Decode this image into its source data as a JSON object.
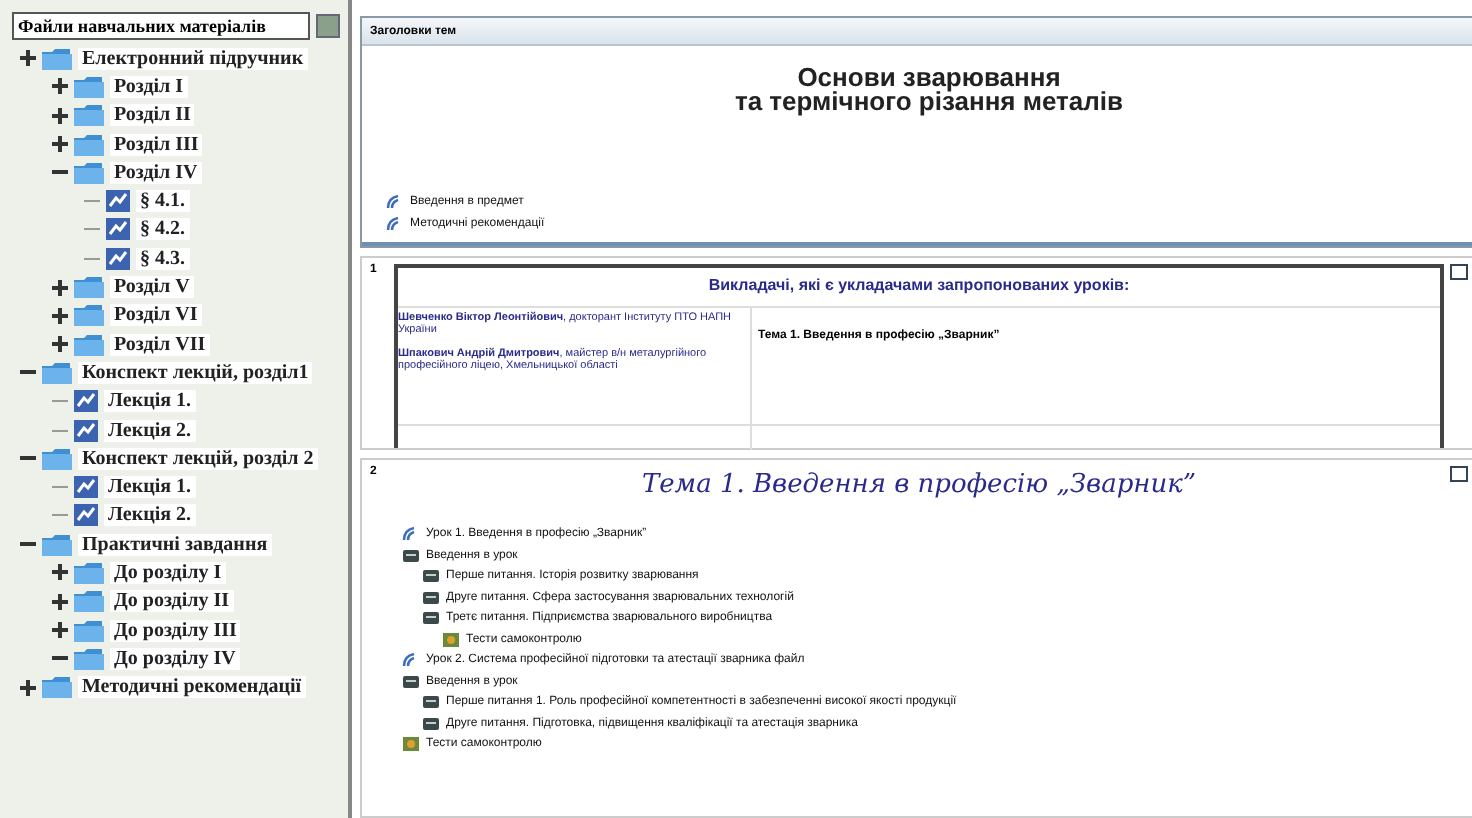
{
  "sidebar": {
    "title": "Файли навчальних матеріалів",
    "tree": [
      {
        "label": "Електронний підручник",
        "kind": "folder",
        "expanded": false,
        "children": [
          {
            "label": "Розділ I",
            "kind": "folder",
            "expanded": false
          },
          {
            "label": "Розділ II",
            "kind": "folder",
            "expanded": false
          },
          {
            "label": "Розділ III",
            "kind": "folder",
            "expanded": false
          },
          {
            "label": "Розділ IV",
            "kind": "folder",
            "expanded": true,
            "children": [
              {
                "label": "§ 4.1.",
                "kind": "page"
              },
              {
                "label": "§ 4.2.",
                "kind": "page"
              },
              {
                "label": "§ 4.3.",
                "kind": "page"
              }
            ]
          },
          {
            "label": "Розділ V",
            "kind": "folder",
            "expanded": false
          },
          {
            "label": "Розділ VI",
            "kind": "folder",
            "expanded": false
          },
          {
            "label": "Розділ VII",
            "kind": "folder",
            "expanded": false
          }
        ]
      },
      {
        "label": "Конспект лекцій, розділ1",
        "kind": "folder",
        "expanded": true,
        "children": [
          {
            "label": "Лекція 1.",
            "kind": "page"
          },
          {
            "label": "Лекція 2.",
            "kind": "page"
          }
        ]
      },
      {
        "label": "Конспект лекцій, розділ 2",
        "kind": "folder",
        "expanded": true,
        "children": [
          {
            "label": "Лекція 1.",
            "kind": "page"
          },
          {
            "label": "Лекція 2.",
            "kind": "page"
          }
        ]
      },
      {
        "label": "Практичні завдання",
        "kind": "folder",
        "expanded": true,
        "children": [
          {
            "label": "До розділу I",
            "kind": "folder",
            "expanded": false
          },
          {
            "label": "До розділу II",
            "kind": "folder",
            "expanded": false
          },
          {
            "label": "До розділу III",
            "kind": "folder",
            "expanded": false
          },
          {
            "label": "До розділу IV",
            "kind": "folder",
            "expanded": true
          }
        ]
      },
      {
        "label": "Методичні рекомендації",
        "kind": "folder",
        "expanded": false
      }
    ]
  },
  "header": {
    "label": "Заголовки тем"
  },
  "course": {
    "title_lines": [
      "Основи зварювання",
      "та термічного різання металів"
    ],
    "links": [
      "Введення в предмет",
      "Методичні рекомендації"
    ]
  },
  "sections": [
    {
      "number": "1",
      "kind": "authors",
      "title": "Викладачі, які є укладачами запропонованих уроків:",
      "authors": [
        "**Шевченко Віктор Леонтійович**, докторант Інституту ПТО НАПН України",
        "**Шпакович Андрій Дмитрович**, майстер в/н металургійного професійного ліцею, Хмельницької області"
      ],
      "topic": "Тема 1. Введення в професію „Зварник”"
    },
    {
      "number": "2",
      "kind": "lessons",
      "title": "Тема 1. Введення в професію „Зварник”",
      "items": [
        {
          "label": "Урок 1. Введення в професію „Зварник”",
          "kind": "link"
        },
        {
          "label": "Введення в урок",
          "kind": "doc",
          "children": [
            {
              "label": "Перше питання. Історія розвитку зварювання",
              "kind": "doc"
            },
            {
              "label": "Друге питання. Сфера застосування зварювальних технологій",
              "kind": "doc"
            },
            {
              "label": "Третє питання. Підприємства зварювального виробництва",
              "kind": "doc",
              "children": [
                {
                  "label": "Тести самоконтролю",
                  "kind": "test"
                }
              ]
            }
          ]
        },
        {
          "label": "Урок 2. Система професійної підготовки та атестації зварника файл",
          "kind": "link"
        },
        {
          "label": "Введення в урок",
          "kind": "doc",
          "children": [
            {
              "label": "Перше питання 1. Роль професійної компетентності в забезпеченні високої якості продукції",
              "kind": "doc"
            },
            {
              "label": "Друге питання. Підготовка, підвищення кваліфікації та атестація зварника",
              "kind": "doc"
            }
          ]
        },
        {
          "label": "Тести самоконтролю",
          "kind": "test"
        }
      ]
    }
  ]
}
